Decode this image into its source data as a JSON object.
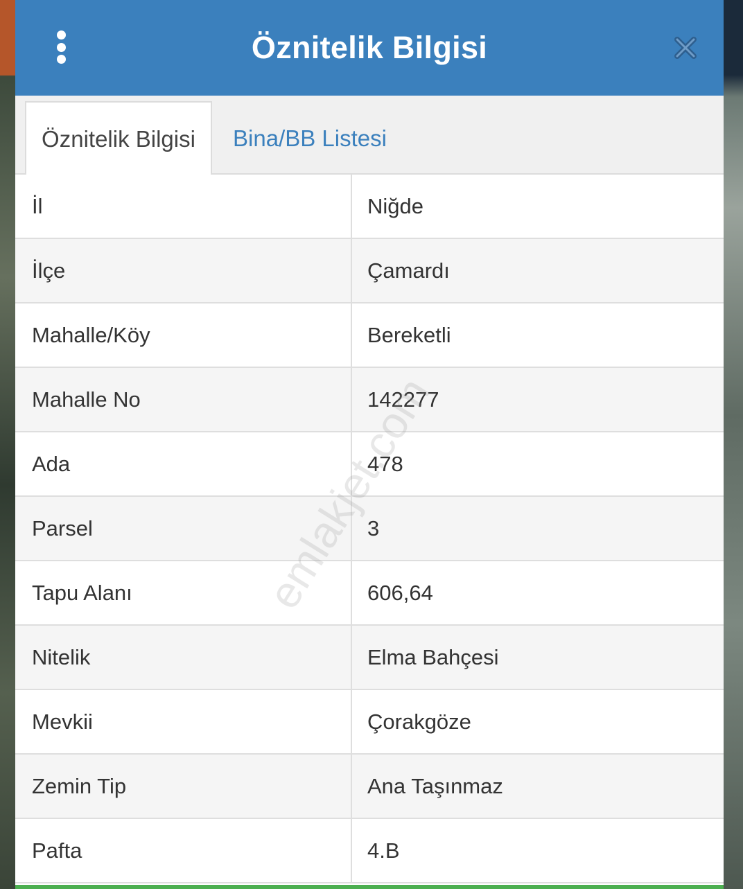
{
  "header": {
    "title": "Öznitelik Bilgisi",
    "accent_color": "#3b80bd",
    "menu_icon": "kebab-menu-icon",
    "close_icon": "close-icon"
  },
  "tabs": [
    {
      "label": "Öznitelik Bilgisi",
      "active": true
    },
    {
      "label": "Bina/BB Listesi",
      "active": false
    }
  ],
  "rows": [
    {
      "key": "İl",
      "value": "Niğde"
    },
    {
      "key": "İlçe",
      "value": "Çamardı"
    },
    {
      "key": "Mahalle/Köy",
      "value": "Bereketli"
    },
    {
      "key": "Mahalle No",
      "value": "142277"
    },
    {
      "key": "Ada",
      "value": "478"
    },
    {
      "key": "Parsel",
      "value": "3"
    },
    {
      "key": "Tapu Alanı",
      "value": "606,64"
    },
    {
      "key": "Nitelik",
      "value": "Elma Bahçesi"
    },
    {
      "key": "Mevkii",
      "value": "Çorakgöze"
    },
    {
      "key": "Zemin Tip",
      "value": "Ana Taşınmaz"
    },
    {
      "key": "Pafta",
      "value": "4.B"
    }
  ],
  "watermark": "emlakjet.com"
}
